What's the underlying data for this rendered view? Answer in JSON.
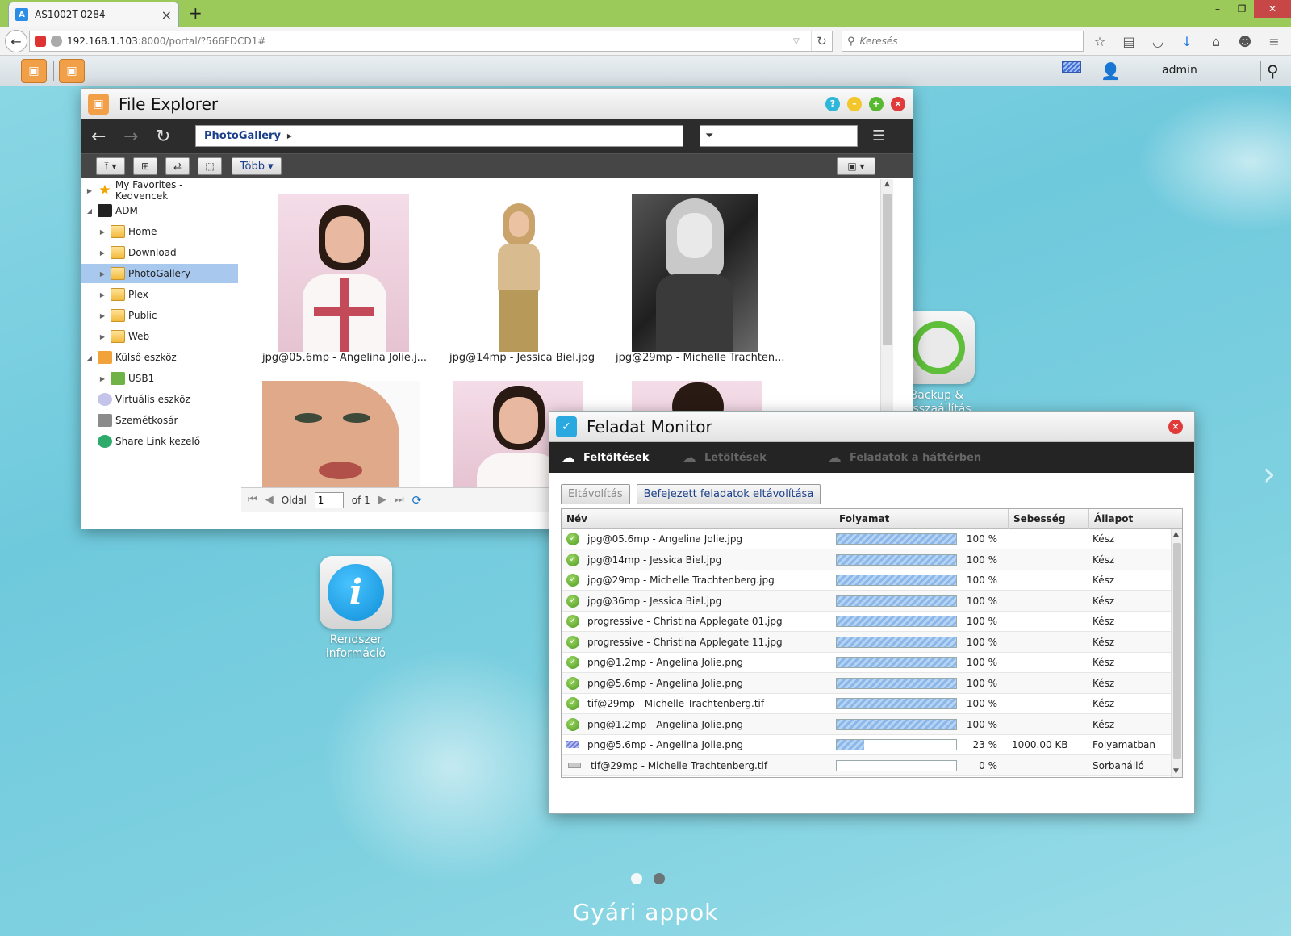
{
  "browser": {
    "tab_title": "AS1002T-0284",
    "url_host": "192.168.1.103",
    "url_rest": ":8000/portal/?566FDCD1#",
    "search_placeholder": "Keresés"
  },
  "adm": {
    "user": "admin"
  },
  "desktop": {
    "info_label_1": "Rendszer",
    "info_label_2": "információ",
    "backup_label_1": "Backup &",
    "backup_label_2": "Visszaállítás",
    "page_label": "Gyári appok"
  },
  "file_explorer": {
    "title": "File Explorer",
    "path": "PhotoGallery",
    "more_label": "Több",
    "tree": [
      {
        "label": "My Favorites - Kedvencek"
      },
      {
        "label": "ADM"
      },
      {
        "label": "Home"
      },
      {
        "label": "Download"
      },
      {
        "label": "PhotoGallery"
      },
      {
        "label": "Plex"
      },
      {
        "label": "Public"
      },
      {
        "label": "Web"
      },
      {
        "label": "Külső eszköz"
      },
      {
        "label": "USB1"
      },
      {
        "label": "Virtuális eszköz"
      },
      {
        "label": "Szemétkosár"
      },
      {
        "label": "Share Link kezelő"
      }
    ],
    "thumbnails": [
      {
        "label": "jpg@05.6mp - Angelina Jolie.j..."
      },
      {
        "label": "jpg@14mp - Jessica Biel.jpg"
      },
      {
        "label": "jpg@29mp - Michelle Trachten..."
      }
    ],
    "pager": {
      "page_label": "Oldal",
      "page_value": "1",
      "of_label": "of 1"
    }
  },
  "task_monitor": {
    "title": "Feladat Monitor",
    "tabs": [
      {
        "label": "Feltöltések"
      },
      {
        "label": "Letöltések"
      },
      {
        "label": "Feladatok a háttérben"
      }
    ],
    "remove_label": "Eltávolítás",
    "remove_done_label": "Befejezett feladatok eltávolítása",
    "columns": {
      "name": "Név",
      "progress": "Folyamat",
      "speed": "Sebesség",
      "status": "Állapot"
    },
    "rows": [
      {
        "name": "jpg@05.6mp - Angelina Jolie.jpg",
        "progress": 100,
        "percent": "100 %",
        "speed": "",
        "status": "Kész"
      },
      {
        "name": "jpg@14mp - Jessica Biel.jpg",
        "progress": 100,
        "percent": "100 %",
        "speed": "",
        "status": "Kész"
      },
      {
        "name": "jpg@29mp - Michelle Trachtenberg.jpg",
        "progress": 100,
        "percent": "100 %",
        "speed": "",
        "status": "Kész"
      },
      {
        "name": "jpg@36mp - Jessica Biel.jpg",
        "progress": 100,
        "percent": "100 %",
        "speed": "",
        "status": "Kész"
      },
      {
        "name": "progressive - Christina Applegate 01.jpg",
        "progress": 100,
        "percent": "100 %",
        "speed": "",
        "status": "Kész"
      },
      {
        "name": "progressive - Christina Applegate 11.jpg",
        "progress": 100,
        "percent": "100 %",
        "speed": "",
        "status": "Kész"
      },
      {
        "name": "png@1.2mp - Angelina Jolie.png",
        "progress": 100,
        "percent": "100 %",
        "speed": "",
        "status": "Kész"
      },
      {
        "name": "png@5.6mp - Angelina Jolie.png",
        "progress": 100,
        "percent": "100 %",
        "speed": "",
        "status": "Kész"
      },
      {
        "name": "tif@29mp - Michelle Trachtenberg.tif",
        "progress": 100,
        "percent": "100 %",
        "speed": "",
        "status": "Kész"
      },
      {
        "name": "png@1.2mp - Angelina Jolie.png",
        "progress": 100,
        "percent": "100 %",
        "speed": "",
        "status": "Kész"
      },
      {
        "name": "png@5.6mp - Angelina Jolie.png",
        "progress": 23,
        "percent": "23 %",
        "speed": "1000.00 KB",
        "status": "Folyamatban"
      },
      {
        "name": "tif@29mp - Michelle Trachtenberg.tif",
        "progress": 0,
        "percent": "0 %",
        "speed": "",
        "status": "Sorbanálló"
      }
    ]
  }
}
